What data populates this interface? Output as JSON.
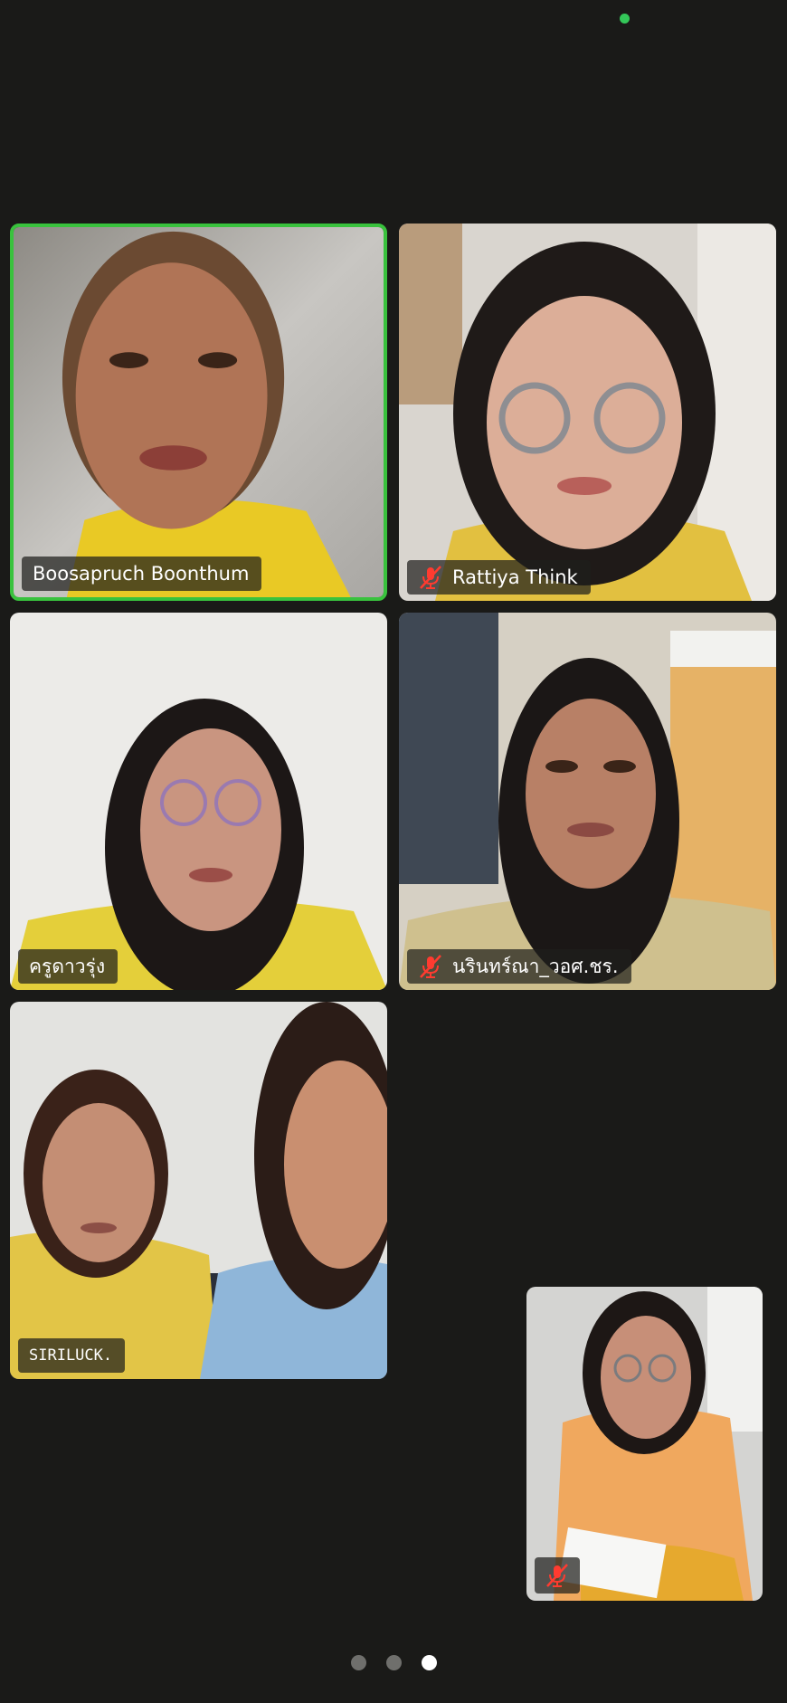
{
  "status": {
    "camera_indicator_color": "#34c759"
  },
  "participants": [
    {
      "name": "Boosapruch Boonthum",
      "muted": false,
      "active_speaker": true
    },
    {
      "name": "Rattiya Think",
      "muted": true,
      "active_speaker": false
    },
    {
      "name": "ครูดาวรุ่ง",
      "muted": false,
      "active_speaker": false
    },
    {
      "name": "นรินทร์ณา_วอศ.ชร.",
      "muted": true,
      "active_speaker": false
    },
    {
      "name": "SIRILUCK.",
      "muted": false,
      "active_speaker": false
    }
  ],
  "self_view": {
    "muted": true
  },
  "pagination": {
    "total_pages": 3,
    "current_page": 3
  },
  "colors": {
    "background": "#1a1a18",
    "active_speaker_border": "#39c23d",
    "muted_icon": "#ff3b30"
  },
  "icons": {
    "muted": "mic-off-icon"
  }
}
